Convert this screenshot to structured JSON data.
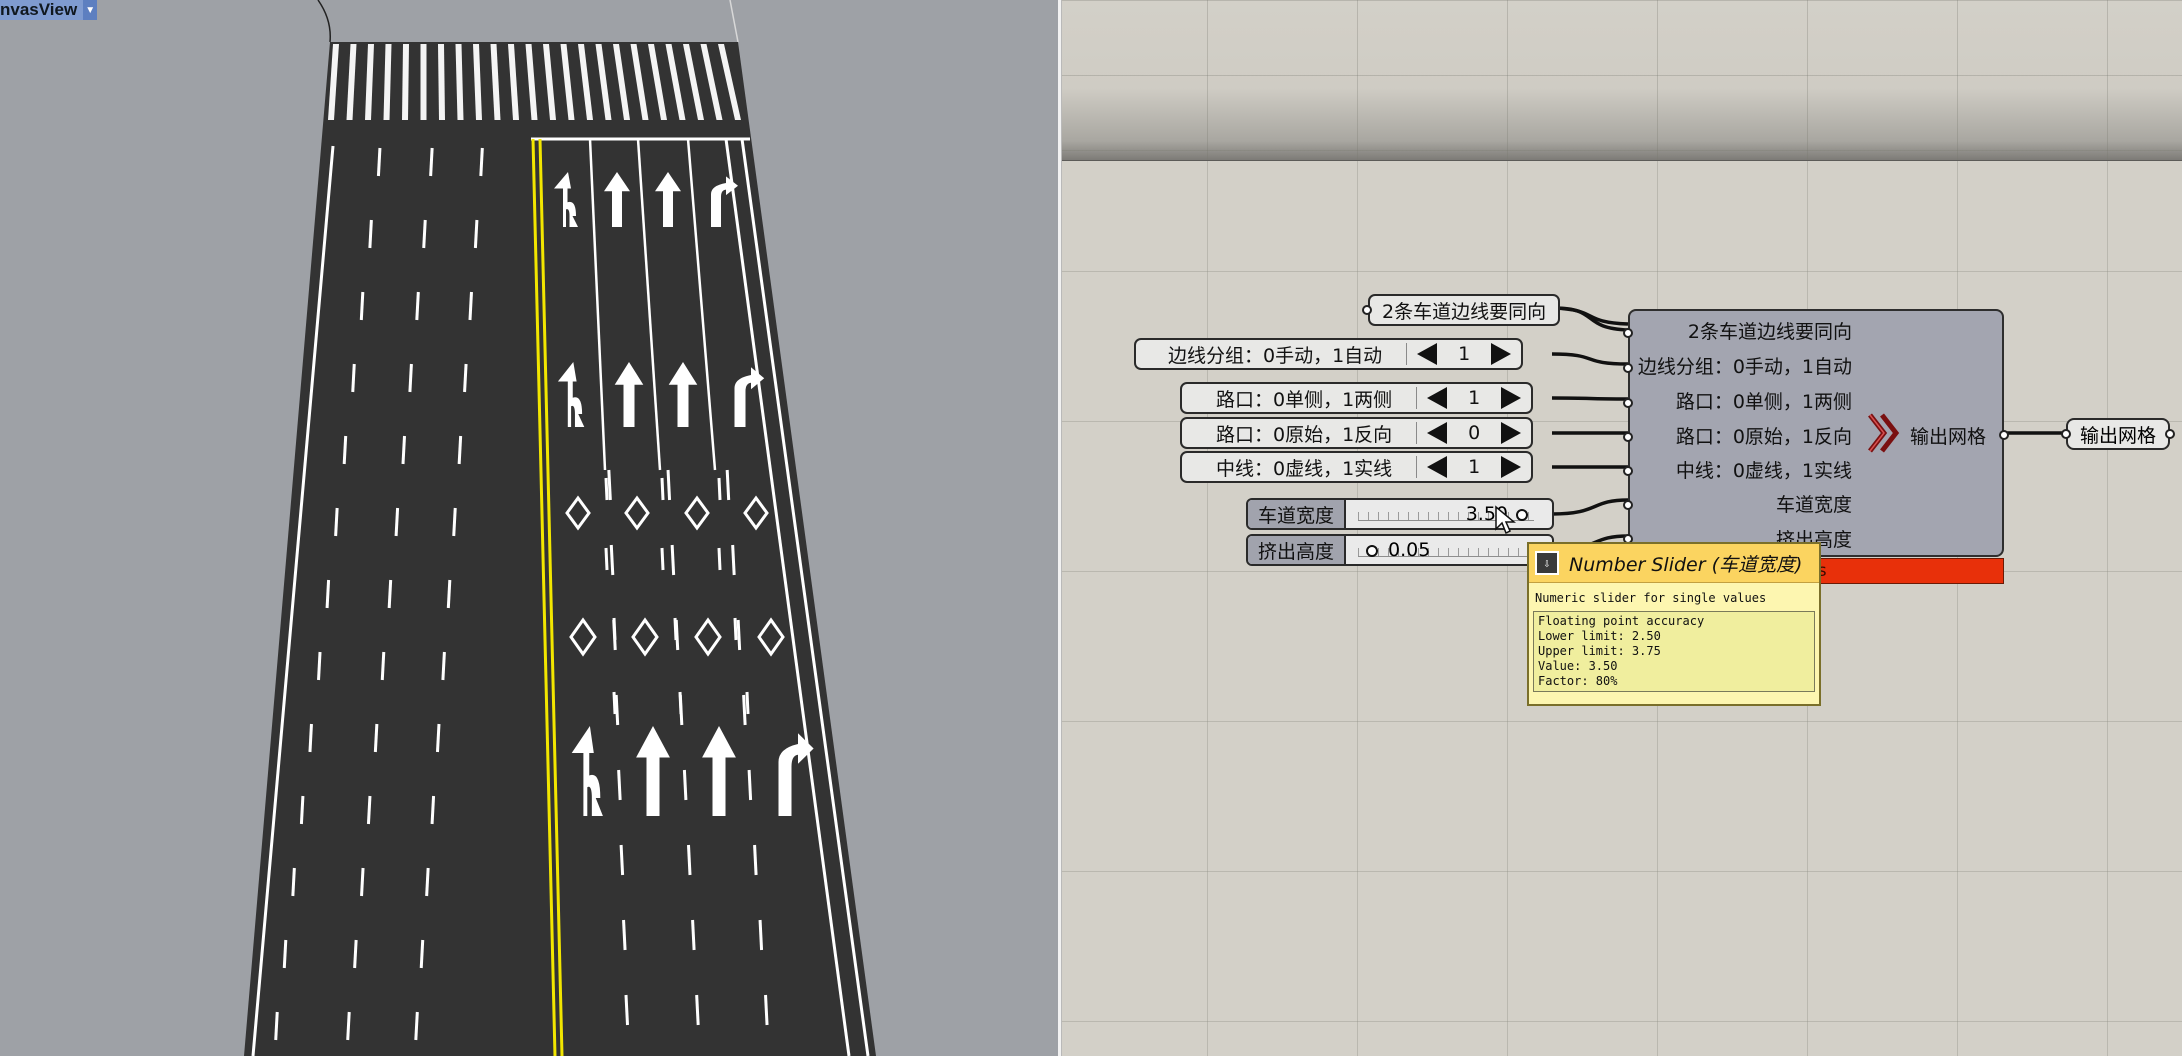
{
  "viewport": {
    "tab_label": "nvasView",
    "background": "#9ea1a6",
    "road_color": "#333333",
    "centerline_color": "#f2e600"
  },
  "canvas": {
    "inputs": [
      {
        "label": "2条车道边线要同向"
      },
      {
        "label": "边线分组：0手动，1自动",
        "value": "1"
      },
      {
        "label": "路口：0单侧，1两侧",
        "value": "1"
      },
      {
        "label": "路口：0原始，1反向",
        "value": "0"
      },
      {
        "label": "中线：0虚线，1实线",
        "value": "1"
      }
    ],
    "sliders": [
      {
        "name": "车道宽度",
        "value": "3.50"
      },
      {
        "name": "挤出高度",
        "value": "0.05"
      }
    ],
    "component": {
      "inputs": [
        "2条车道边线要同向",
        "边线分组：0手动，1自动",
        "路口：0单侧，1两侧",
        "路口：0原始，1反向",
        "中线：0虚线，1实线",
        "车道宽度",
        "挤出高度"
      ],
      "output": "输出网格",
      "error_text": "ns",
      "error_color": "#e8300a"
    },
    "output_node": {
      "label": "输出网格"
    },
    "tooltip": {
      "title": "Number Slider (车道宽度)",
      "description": "Numeric slider for single values",
      "details": "Floating point accuracy\nLower limit: 2.50\nUpper limit: 3.75\nValue: 3.50\nFactor: 80%"
    }
  }
}
